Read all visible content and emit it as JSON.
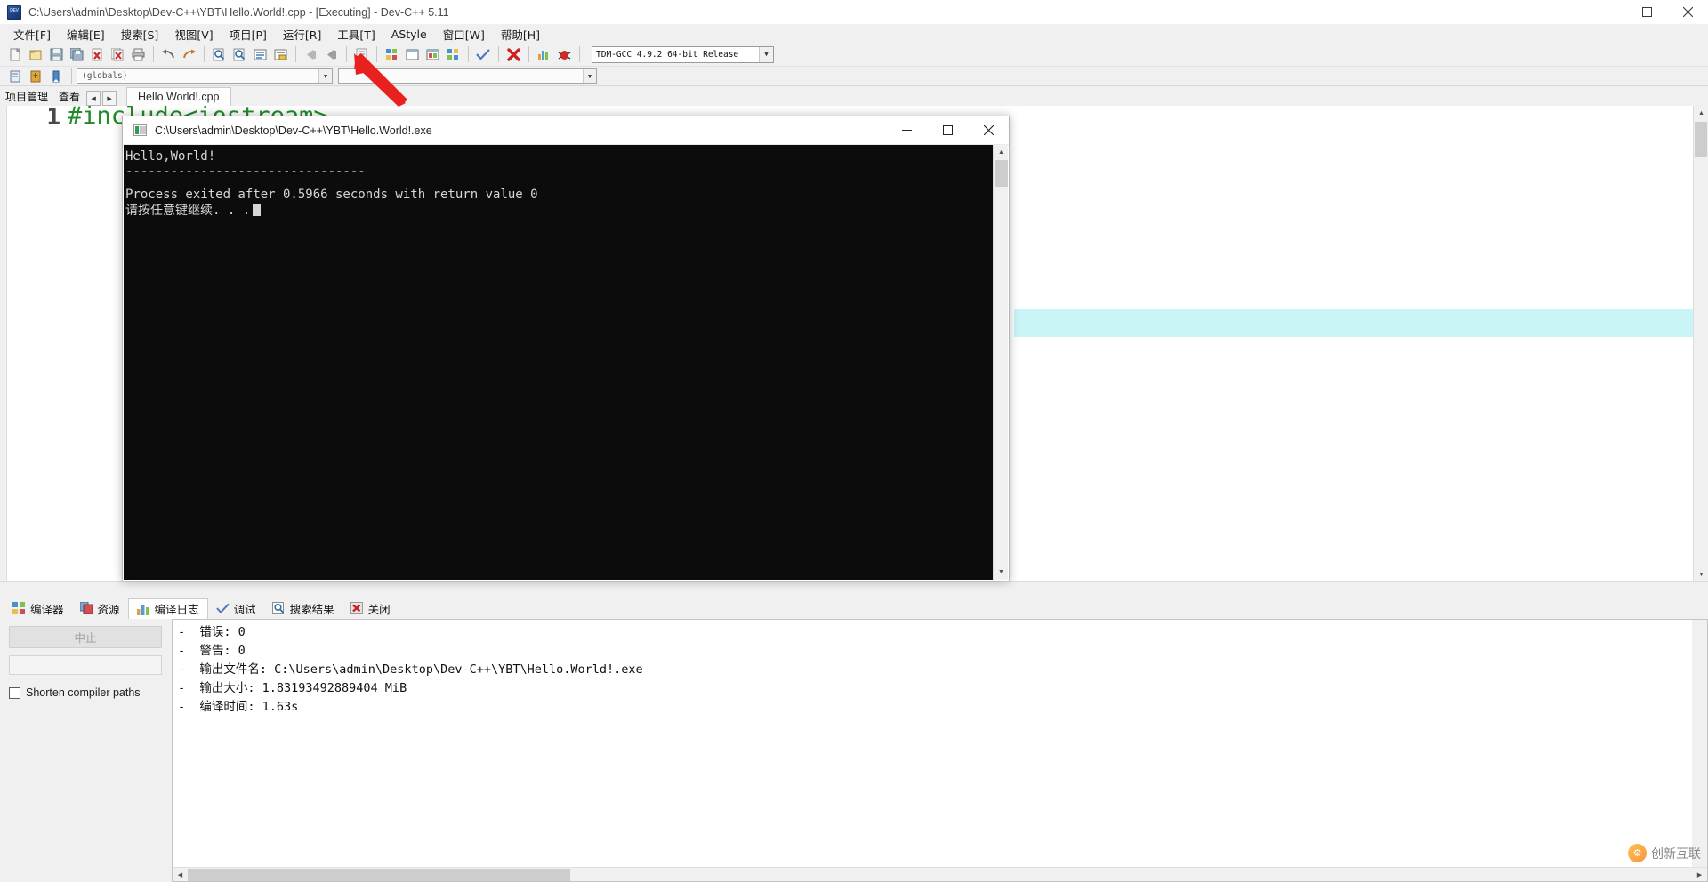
{
  "window": {
    "title": "C:\\Users\\admin\\Desktop\\Dev-C++\\YBT\\Hello.World!.cpp - [Executing] - Dev-C++ 5.11",
    "minimize": "─",
    "maximize": "☐",
    "close": "✕"
  },
  "menu": [
    {
      "label": "文件[F]"
    },
    {
      "label": "编辑[E]"
    },
    {
      "label": "搜索[S]"
    },
    {
      "label": "视图[V]"
    },
    {
      "label": "项目[P]"
    },
    {
      "label": "运行[R]"
    },
    {
      "label": "工具[T]"
    },
    {
      "label": "AStyle"
    },
    {
      "label": "窗口[W]"
    },
    {
      "label": "帮助[H]"
    }
  ],
  "toolbar": {
    "compiler_value": "TDM-GCC 4.9.2 64-bit Release",
    "compiler_arrow": "▼",
    "buttons": [
      "new-file-icon",
      "open-file-icon",
      "save-icon",
      "save-all-icon",
      "close-file-icon",
      "close-all-icon",
      "print-icon",
      "undo-icon",
      "redo-icon",
      "find-icon",
      "find-replace-icon",
      "goto-line-icon",
      "goto-function-icon",
      "back-icon",
      "forward-icon",
      "toggle-icon",
      "compile-icon",
      "run-icon",
      "compile-run-icon",
      "rebuild-all-icon",
      "syntax-check-icon",
      "stop-execution-icon",
      "profile-icon",
      "debug-icon"
    ]
  },
  "toolbar2": {
    "globals_value": "(globals)",
    "symbol_value": "",
    "arrow": "▼",
    "buttons": [
      "insert-icon",
      "toggle-bookmark-icon",
      "goto-bookmark-icon"
    ]
  },
  "panelTabs": {
    "project": "项目管理",
    "view": "查看",
    "prev": "◀",
    "next": "▶",
    "file_tab": "Hello.World!.cpp"
  },
  "editor": {
    "lines": [
      {
        "number": "1",
        "text": "#include<iostream>"
      }
    ]
  },
  "console": {
    "title": "C:\\Users\\admin\\Desktop\\Dev-C++\\YBT\\Hello.World!.exe",
    "minimize": "─",
    "maximize": "☐",
    "close": "✕",
    "line1": "Hello,World!",
    "line2": "--------------------------------",
    "line3": "Process exited after 0.5966 seconds with return value 0",
    "line4": "请按任意键继续. . ."
  },
  "bottomTabs": [
    {
      "label": "编译器",
      "icon": "compiler-icon",
      "active": false
    },
    {
      "label": "资源",
      "icon": "resource-icon",
      "active": false
    },
    {
      "label": "编译日志",
      "icon": "compile-log-icon",
      "active": true
    },
    {
      "label": "调试",
      "icon": "debug-check-icon",
      "active": false
    },
    {
      "label": "搜索结果",
      "icon": "search-results-icon",
      "active": false
    },
    {
      "label": "关闭",
      "icon": "close-red-icon",
      "active": false
    }
  ],
  "bottomLeft": {
    "abort_label": "中止",
    "progress_value": "",
    "shorten_label": "Shorten compiler paths"
  },
  "compileLog": {
    "lines": [
      "-  错误: 0",
      "-  警告: 0",
      "-  输出文件名: C:\\Users\\admin\\Desktop\\Dev-C++\\YBT\\Hello.World!.exe",
      "-  输出大小: 1.83193492889404 MiB",
      "-  编译时间: 1.63s"
    ]
  },
  "scroll": {
    "up": "▲",
    "down": "▼",
    "left": "◀",
    "right": "▶"
  },
  "watermark": {
    "text": "创新互联",
    "glyph": "⚙"
  },
  "colors": {
    "accent": "#c9f5f7",
    "console_bg": "#0c0c0c",
    "console_fg": "#d6d6d6",
    "code_green": "#1f8b28",
    "arrow_red": "#e8201e"
  }
}
